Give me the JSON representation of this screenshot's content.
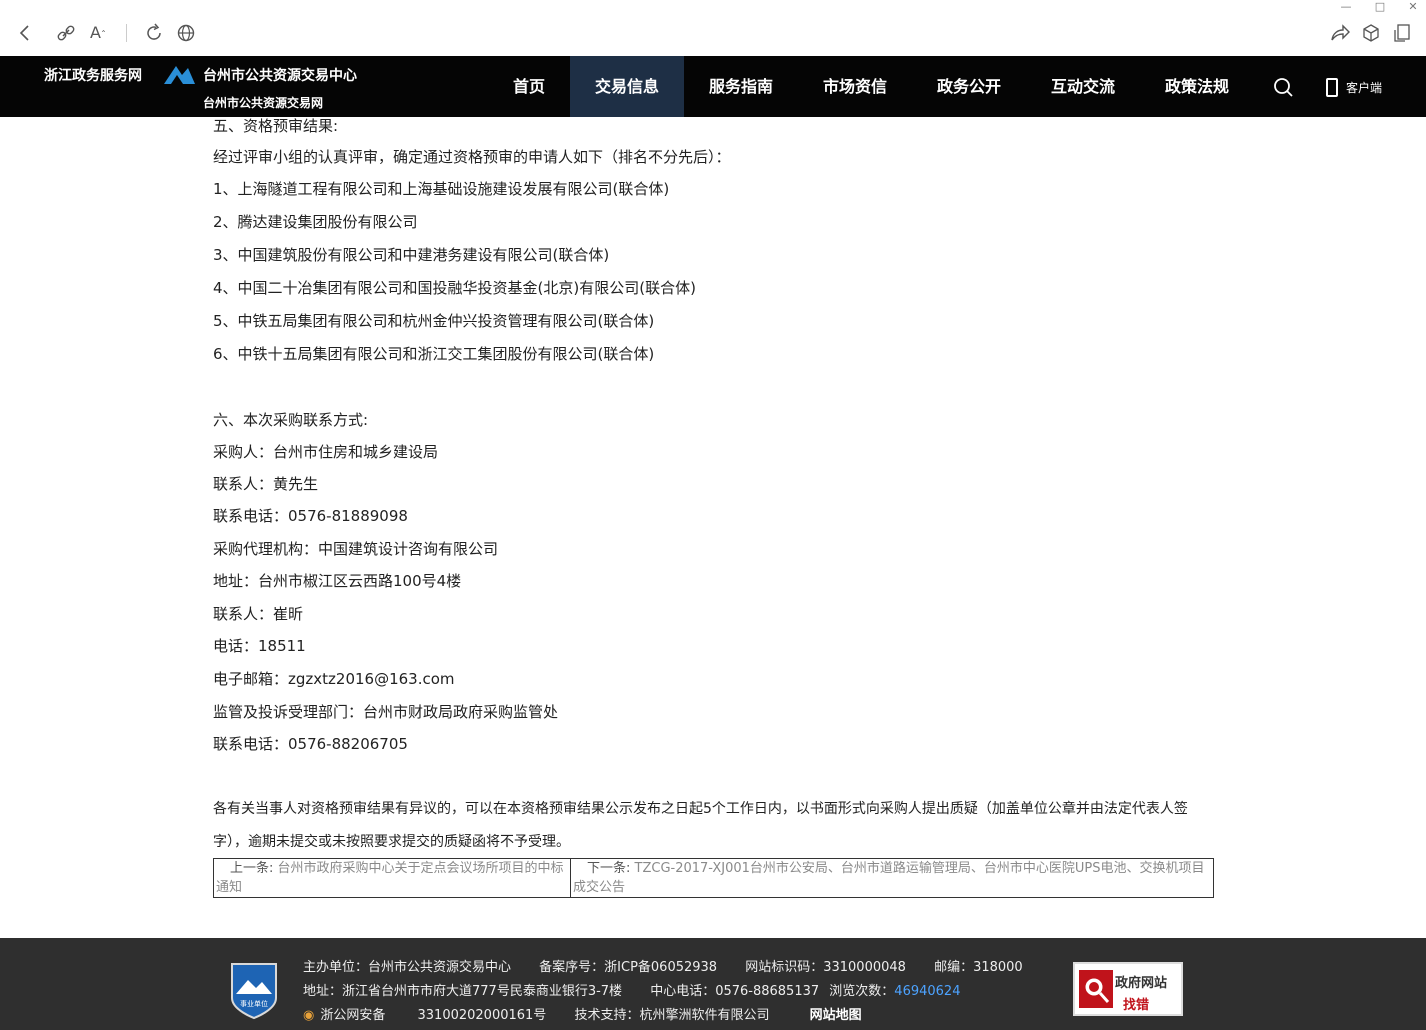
{
  "browser": {
    "icons": [
      "back-icon",
      "link-icon",
      "reader-font-icon",
      "refresh-icon",
      "globe-icon",
      "share-icon",
      "cube-icon",
      "tab-icon"
    ]
  },
  "header": {
    "brand_left": "浙江政务服务网",
    "brand_center": "台州市公共资源交易中心",
    "brand_sub": "台州市公共资源交易网",
    "nav": [
      "首页",
      "交易信息",
      "服务指南",
      "市场资信",
      "政务公开",
      "互动交流",
      "政策法规"
    ],
    "active_nav": "交易信息",
    "client_label": "客户端"
  },
  "article": {
    "section5_title": "五、资格预审结果:",
    "section5_intro": "经过评审小组的认真评审，确定通过资格预审的申请人如下（排名不分先后）：",
    "applicants": [
      "1、上海隧道工程有限公司和上海基础设施建设发展有限公司(联合体)",
      "2、腾达建设集团股份有限公司",
      "3、中国建筑股份有限公司和中建港务建设有限公司(联合体)",
      "4、中国二十冶集团有限公司和国投融华投资基金(北京)有限公司(联合体)",
      "5、中铁五局集团有限公司和杭州金仲兴投资管理有限公司(联合体)",
      "6、中铁十五局集团有限公司和浙江交工集团股份有限公司(联合体)"
    ],
    "section6_title": "六、本次采购联系方式:",
    "contacts": [
      "采购人：台州市住房和城乡建设局",
      "联系人：黄先生",
      "联系电话：0576-81889098",
      "采购代理机构：中国建筑设计咨询有限公司",
      "地址：台州市椒江区云西路100号4楼",
      "联系人：崔昕",
      "电话：18511",
      "电子邮箱：zgzxtz2016@163.com",
      "监管及投诉受理部门：台州市财政局政府采购监管处",
      "联系电话：0576-88206705"
    ],
    "notice": "各有关当事人对资格预审结果有异议的，可以在本资格预审结果公示发布之日起5个工作日内，以书面形式向采购人提出质疑（加盖单位公章并由法定代表人签字），逾期未提交或未按照要求提交的质疑函将不予受理。"
  },
  "prevnext": {
    "prev_label": "上一条:",
    "prev_title": "台州市政府采购中心关于定点会议场所项目的中标通知",
    "next_label": "下一条:",
    "next_title": "TZCG-2017-XJ001台州市公安局、台州市道路运输管理局、台州市中心医院UPS电池、交换机项目成交公告"
  },
  "footer": {
    "badge_text": "事业单位",
    "host": "主办单位：台州市公共资源交易中心",
    "icp": "备案序号：浙ICP备06052938",
    "site_id": "网站标识码：3310000048",
    "postcode": "邮编：318000",
    "address": "地址：浙江省台州市市府大道777号民泰商业银行3-7楼",
    "phone": "中心电话：0576-88685137",
    "visits_label": "浏览次数：",
    "visits": "46940624",
    "police_label": "浙公网安备",
    "police_no": "33100202000161号",
    "tech": "技术支持：杭州擎洲软件有限公司",
    "sitemap": "网站地图",
    "report_line1": "政府网站",
    "report_line2": "找错"
  }
}
